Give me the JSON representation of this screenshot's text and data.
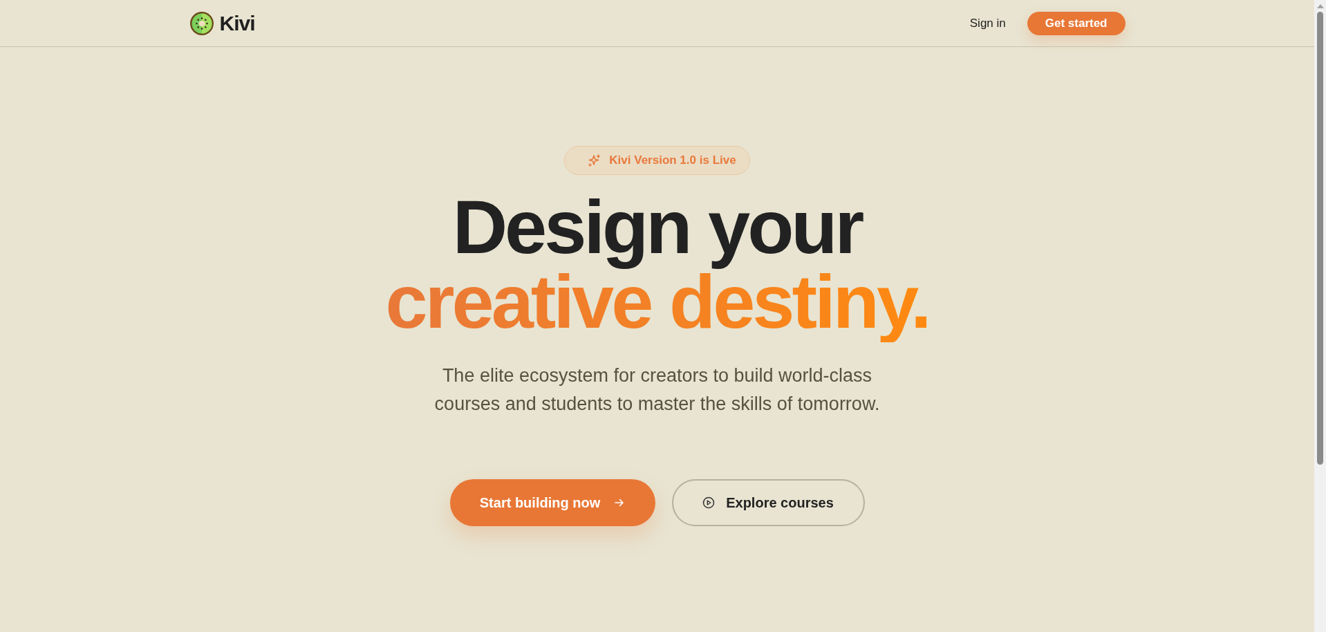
{
  "header": {
    "brand": "Kivi",
    "sign_in": "Sign in",
    "cta": "Get started"
  },
  "hero": {
    "badge": "Kivi Version 1.0 is Live",
    "headline": [
      "Design your",
      "creative destiny."
    ],
    "subtitle": "The elite ecosystem for creators to build world-class courses and students to master the skills of tomorrow.",
    "buttons": [
      {
        "kind": "primary",
        "label": "Start building now"
      },
      {
        "kind": "secondary",
        "label": "Explore courses"
      }
    ]
  }
}
